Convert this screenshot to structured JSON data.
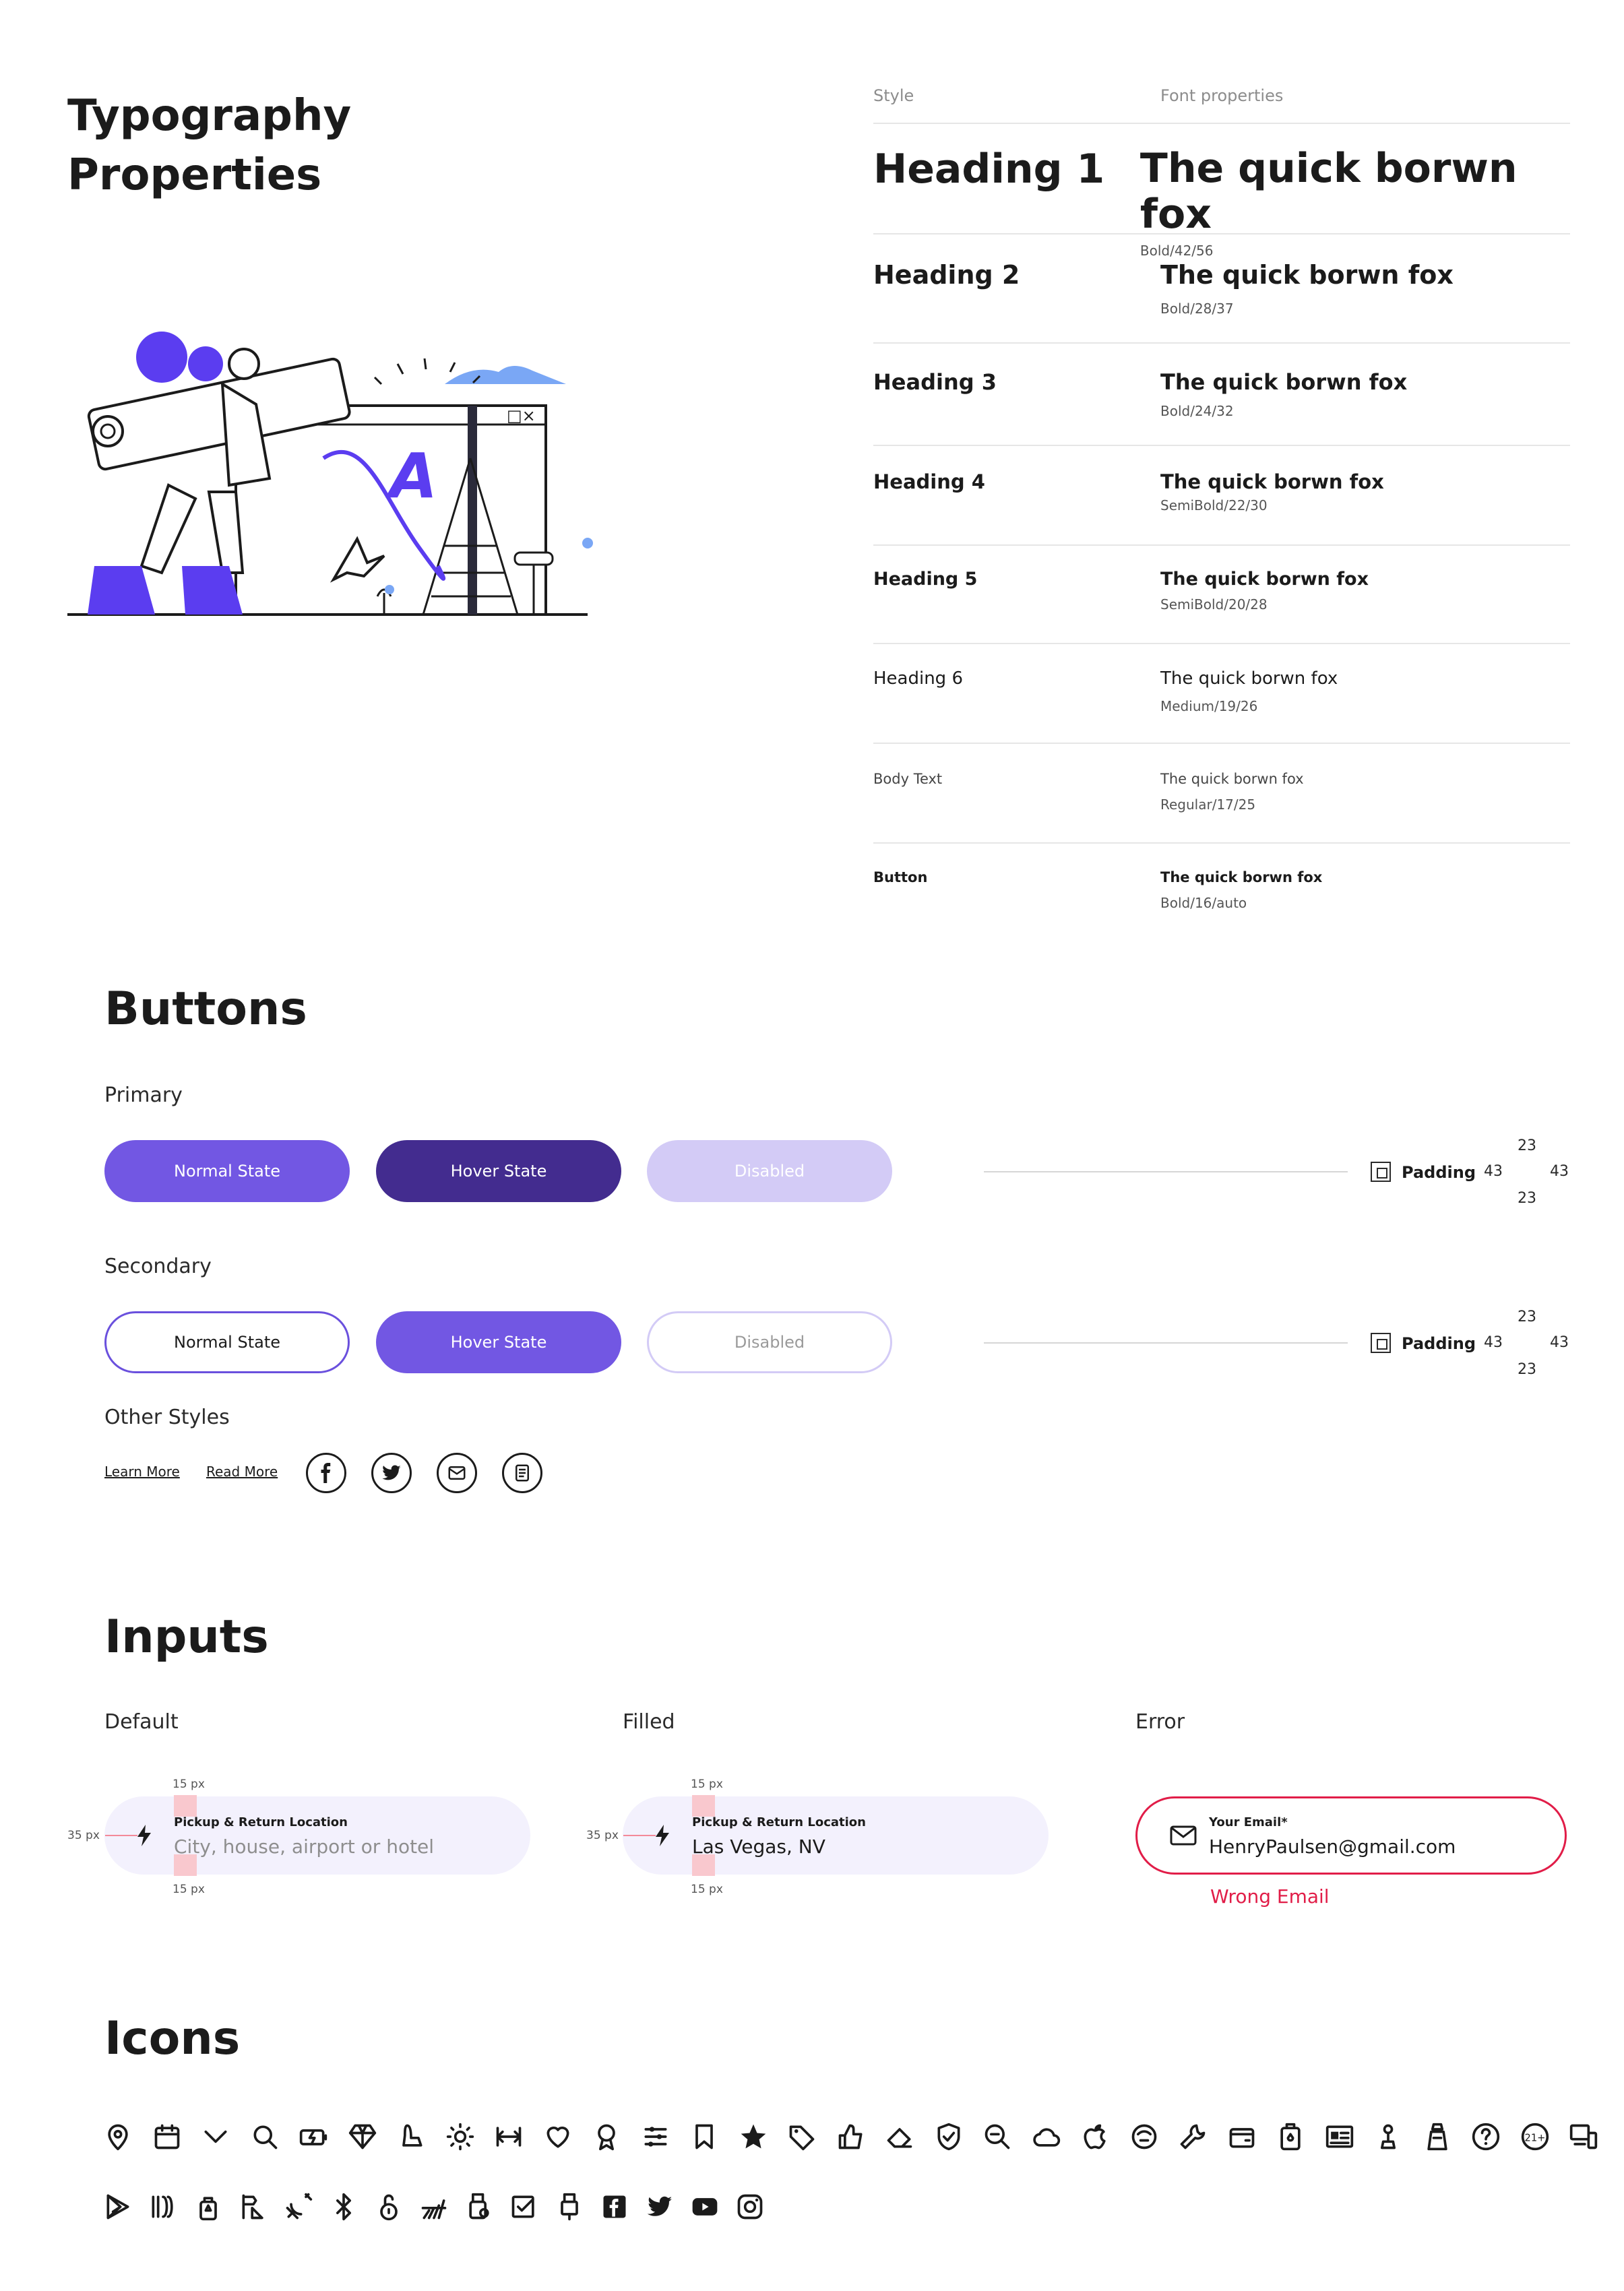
{
  "typography": {
    "title_line1": "Typography",
    "title_line2": "Properties",
    "col_style": "Style",
    "col_font": "Font properties",
    "rows": [
      {
        "style": "Heading 1",
        "sample": "The quick borwn fox",
        "props": "Bold/42/56"
      },
      {
        "style": "Heading 2",
        "sample": "The quick borwn fox",
        "props": "Bold/28/37"
      },
      {
        "style": "Heading 3",
        "sample": "The quick borwn fox",
        "props": "Bold/24/32"
      },
      {
        "style": "Heading 4",
        "sample": "The quick borwn fox",
        "props": "SemiBold/22/30"
      },
      {
        "style": "Heading 5",
        "sample": "The quick borwn fox",
        "props": "SemiBold/20/28"
      },
      {
        "style": "Heading 6",
        "sample": "The quick borwn fox",
        "props": "Medium/19/26"
      },
      {
        "style": "Body Text",
        "sample": "The quick borwn fox",
        "props": "Regular/17/25"
      },
      {
        "style": "Button",
        "sample": "The quick borwn fox",
        "props": "Bold/16/auto"
      }
    ]
  },
  "buttons": {
    "title": "Buttons",
    "primary_label": "Primary",
    "secondary_label": "Secondary",
    "other_label": "Other Styles",
    "normal": "Normal State",
    "hover": "Hover State",
    "disabled": "Disabled",
    "padding_label": "Padding",
    "padding_vertical": "23",
    "padding_horizontal": "43",
    "learn_more": "Learn More",
    "read_more": "Read More",
    "social_icons": [
      "facebook-icon",
      "twitter-icon",
      "mail-icon",
      "document-icon"
    ],
    "colors": {
      "primary": "#7257e3",
      "hover": "#432c8f",
      "disabled": "#d3cbf6"
    }
  },
  "inputs": {
    "title": "Inputs",
    "default_label": "Default",
    "filled_label": "Filled",
    "error_label": "Error",
    "default_field": {
      "label": "Pickup & Return Location",
      "placeholder": "City, house, airport or hotel"
    },
    "filled_field": {
      "label": "Pickup & Return Location",
      "value": "Las Vegas, NV"
    },
    "error_field": {
      "label": "Your Email*",
      "value": "HenryPaulsen@gmail.com",
      "message": "Wrong Email"
    },
    "measure_15": "15 px",
    "measure_35": "35 px",
    "colors": {
      "error": "#e11d48",
      "fill": "#f3f1fd"
    }
  },
  "icons": {
    "title": "Icons",
    "row1": [
      "location-pin-icon",
      "calendar-icon",
      "chevron-down-icon",
      "search-icon",
      "battery-charging-icon",
      "diamond-icon",
      "car-seat-icon",
      "sun-icon",
      "width-icon",
      "heart-icon",
      "award-icon",
      "sliders-icon",
      "bookmark-icon",
      "star-icon",
      "tag-icon",
      "thumbs-up-icon",
      "eraser-icon",
      "shield-check-icon",
      "zoom-icon",
      "cloud-icon",
      "apple-icon",
      "driver-icon",
      "wrench-icon",
      "wallet-icon",
      "fuel-can-icon",
      "id-card-icon",
      "gear-shift-icon",
      "seat-icon",
      "help-icon",
      "age-21-icon",
      "devices-icon"
    ],
    "row2": [
      "play-store-icon",
      "wheels-icon",
      "spray-icon",
      "signs-icon",
      "satellite-off-icon",
      "bluetooth-icon",
      "unlock-icon",
      "tools-icon",
      "usb-drive-icon",
      "checkbox-icon",
      "usb-icon",
      "facebook-icon",
      "twitter-icon",
      "youtube-icon",
      "instagram-icon"
    ],
    "age_text": "21+"
  },
  "illustration": {
    "letter": "A"
  }
}
